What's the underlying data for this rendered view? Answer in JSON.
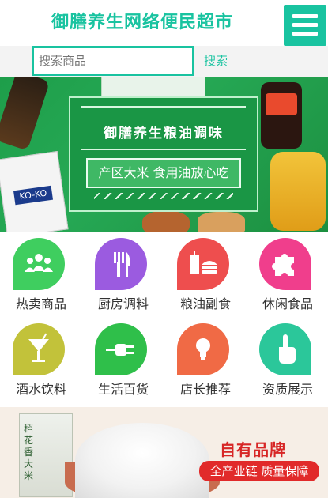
{
  "header": {
    "title": "御膳养生网络便民超市",
    "menu_icon": "hamburger-menu-icon"
  },
  "search": {
    "placeholder": "搜索商品",
    "value": "",
    "button_label": "搜索"
  },
  "banner": {
    "title": "御膳养生粮油调味",
    "subtitle": "产区大米 食用油放心吃"
  },
  "categories": [
    {
      "label": "热卖商品",
      "icon": "people-group-icon",
      "color": "#3fce5f"
    },
    {
      "label": "厨房调料",
      "icon": "fork-knife-icon",
      "color": "#9b5be0"
    },
    {
      "label": "粮油副食",
      "icon": "burger-drink-icon",
      "color": "#ee4e4e"
    },
    {
      "label": "休闲食品",
      "icon": "puzzle-piece-icon",
      "color": "#f03e8c"
    },
    {
      "label": "酒水饮料",
      "icon": "cocktail-glass-icon",
      "color": "#c2c23a"
    },
    {
      "label": "生活百货",
      "icon": "plug-icon",
      "color": "#2fbf4a"
    },
    {
      "label": "店长推荐",
      "icon": "lightbulb-icon",
      "color": "#f06a45"
    },
    {
      "label": "资质展示",
      "icon": "pointing-hand-icon",
      "color": "#2bc79a"
    }
  ],
  "promo": {
    "title": "自有品牌",
    "tag": "全产业链 质量保障",
    "bag_text": "稻花香大米"
  },
  "colors": {
    "accent": "#19c3a0",
    "banner_green": "#1e9e4a",
    "promo_red": "#e12a2a"
  }
}
